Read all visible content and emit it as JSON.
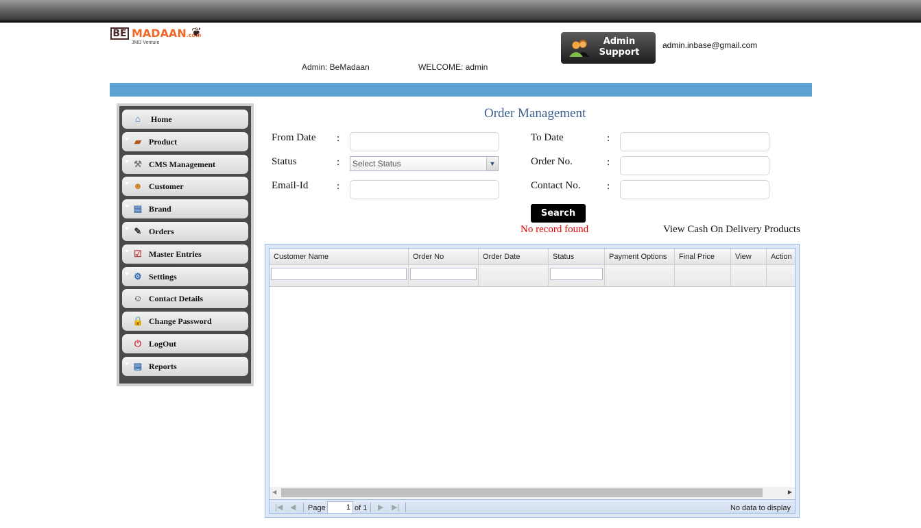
{
  "header": {
    "logo": {
      "be": "BE",
      "madaan": "MADAAN",
      "com": ".com",
      "tagline": "JMD Venture"
    },
    "admin_label": "Admin: BeMadaan",
    "welcome_label": "WELCOME: admin",
    "support_button": {
      "line1": "Admin",
      "line2": "Support"
    },
    "support_email": "admin.inbase@gmail.com"
  },
  "colors": {
    "accent_bar": "#5da3d2",
    "title": "#3a5f8f",
    "error": "#e00000"
  },
  "sidebar": {
    "items": [
      {
        "label": "Home",
        "icon": "home-icon",
        "glyph": "⌂",
        "expandable": false
      },
      {
        "label": "Product",
        "icon": "product-box-icon",
        "glyph": "▰",
        "expandable": true
      },
      {
        "label": "CMS Management",
        "icon": "cms-tools-icon",
        "glyph": "⚒",
        "expandable": true
      },
      {
        "label": "Customer",
        "icon": "customer-icon",
        "glyph": "☻",
        "expandable": true
      },
      {
        "label": "Brand",
        "icon": "list-icon",
        "glyph": "▤",
        "expandable": true
      },
      {
        "label": "Orders",
        "icon": "orders-icon",
        "glyph": "✎",
        "expandable": true
      },
      {
        "label": "Master Entries",
        "icon": "checklist-icon",
        "glyph": "☑",
        "expandable": true
      },
      {
        "label": "Settings",
        "icon": "gear-icon",
        "glyph": "⚙",
        "expandable": true
      },
      {
        "label": "Contact Details",
        "icon": "contact-person-icon",
        "glyph": "☺",
        "expandable": false
      },
      {
        "label": "Change Password",
        "icon": "lock-icon",
        "glyph": "🔒",
        "expandable": false
      },
      {
        "label": "LogOut",
        "icon": "power-icon",
        "glyph": "⏻",
        "expandable": false
      },
      {
        "label": "Reports",
        "icon": "report-icon",
        "glyph": "▤",
        "expandable": true
      }
    ]
  },
  "main": {
    "title": "Order Management",
    "filters": {
      "from_date": {
        "label": "From Date",
        "value": ""
      },
      "to_date": {
        "label": "To Date",
        "value": ""
      },
      "status": {
        "label": "Status",
        "selected": "Select Status"
      },
      "order_no": {
        "label": "Order No.",
        "value": ""
      },
      "email": {
        "label": "Email-Id",
        "value": ""
      },
      "contact": {
        "label": "Contact No.",
        "value": ""
      },
      "colon": ":"
    },
    "search_label": "Search",
    "no_record": "No record found",
    "cod_link": "View Cash On Delivery Products"
  },
  "grid": {
    "columns": [
      "Customer Name",
      "Order No",
      "Order Date",
      "Status",
      "Payment Options",
      "Final Price",
      "View",
      "Action"
    ],
    "rows": [],
    "pager": {
      "page_label": "Page",
      "page_value": "1",
      "of_label": "of 1",
      "status": "No data to display"
    }
  }
}
